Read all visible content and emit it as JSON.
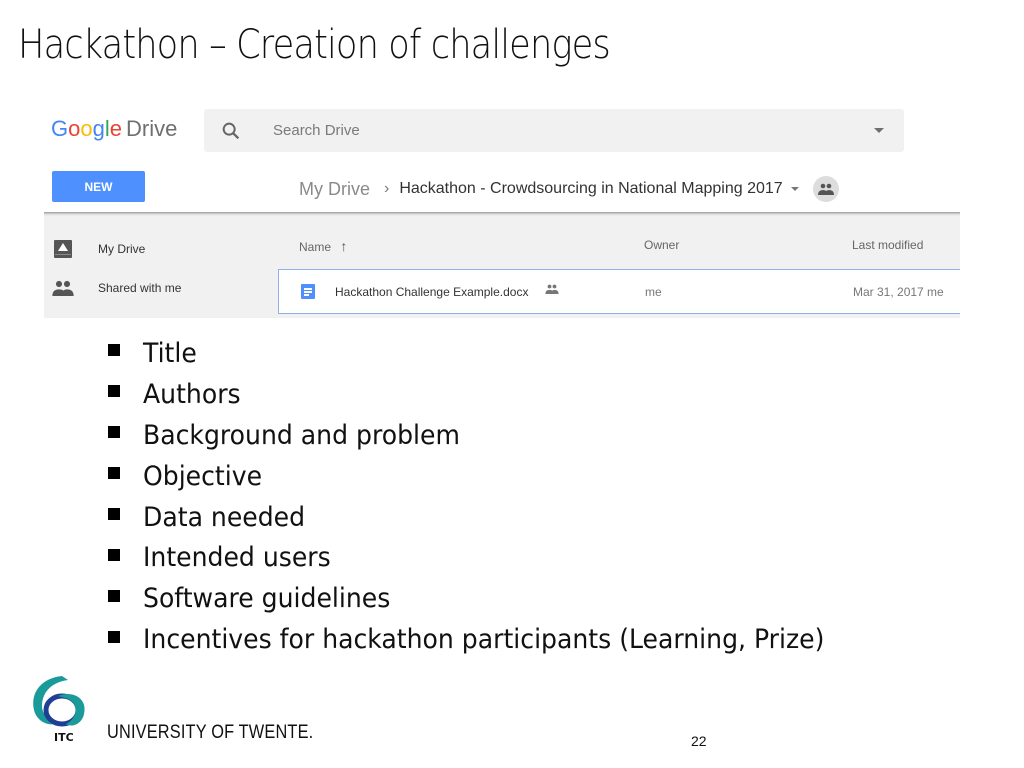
{
  "slide": {
    "title": "Hackathon – Creation of challenges",
    "page_number": "22"
  },
  "drive": {
    "logo": {
      "google_letters": [
        "G",
        "o",
        "o",
        "g",
        "l",
        "e"
      ],
      "product": "Drive"
    },
    "search": {
      "placeholder": "Search Drive",
      "icon": "search-icon"
    },
    "new_button": "NEW",
    "breadcrumb": {
      "root": "My Drive",
      "separator": "›",
      "current": "Hackathon - Crowdsourcing in National Mapping 2017"
    },
    "sidebar": [
      {
        "label": "My Drive",
        "icon": "drive-icon"
      },
      {
        "label": "Shared with me",
        "icon": "people-icon"
      }
    ],
    "columns": {
      "name": "Name",
      "sort": "↑",
      "owner": "Owner",
      "modified": "Last modified"
    },
    "files": [
      {
        "name": "Hackathon Challenge Example.docx",
        "shared": true,
        "owner": "me",
        "modified": "Mar 31, 2017 me"
      }
    ],
    "colors": {
      "accent": "#4d90fe",
      "search_bg": "#f1f1f1",
      "list_bg": "#f1f1f1"
    }
  },
  "bullets": [
    "Title",
    "Authors",
    "Background and problem",
    "Objective",
    "Data needed",
    "Intended users",
    "Software guidelines",
    "Incentives for hackathon participants (Learning, Prize)"
  ],
  "footer": {
    "logo_text": "ITC",
    "university": "UNIVERSITY OF TWENTE."
  }
}
